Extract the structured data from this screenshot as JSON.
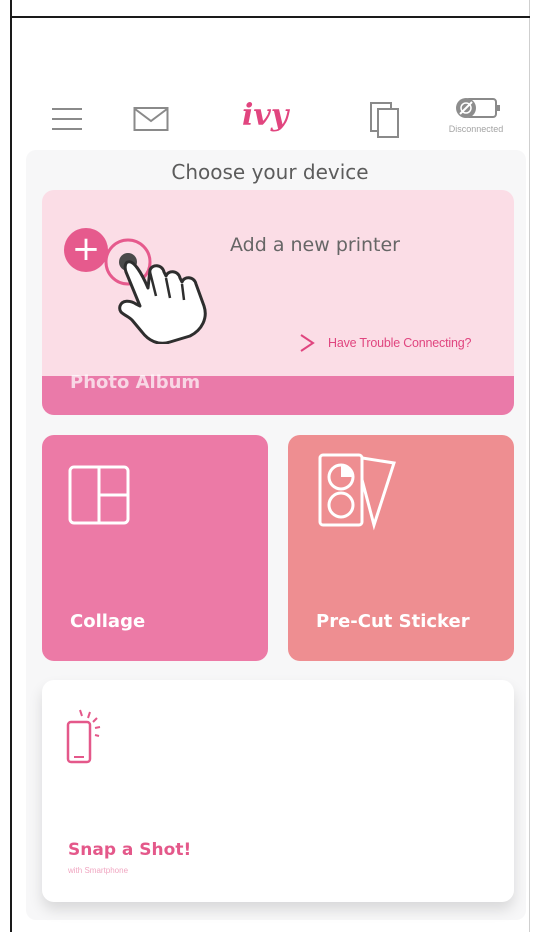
{
  "header": {
    "logo": "ivy",
    "status": "Disconnected",
    "icons": [
      "menu-icon",
      "mail-icon",
      "gallery-icon",
      "printer-status-icon"
    ]
  },
  "main": {
    "title": "Choose your device",
    "add_printer_label": "Add a new printer",
    "trouble_link": "Have Trouble Connecting?",
    "photo_album_label": "Photo Album",
    "cards": {
      "collage": "Collage",
      "sticker": "Pre-Cut Sticker",
      "snap_title": "Snap a Shot!",
      "snap_sub": "with Smartphone"
    }
  },
  "colors": {
    "accent": "#e1457f",
    "printer_card_bg": "#fbdde6",
    "collage_bg": "#ec7aa6",
    "sticker_bg": "#ee8e91",
    "album_strip": "#ea7aa9"
  }
}
